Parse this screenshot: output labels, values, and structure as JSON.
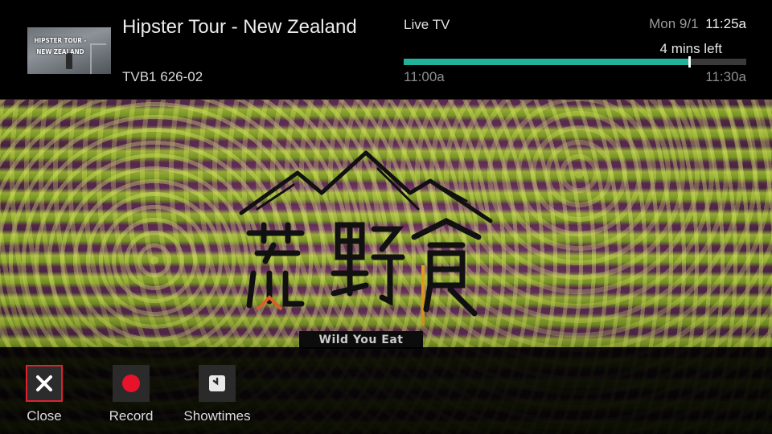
{
  "program": {
    "title": "Hipster Tour - New Zealand",
    "channel_code": "TVB1 626-02",
    "thumbnail_text": "HIPSTER TOUR -\nNEW ZEALAND"
  },
  "status": {
    "source": "Live TV",
    "date": "Mon 9/1",
    "time": "11:25a",
    "time_left": "4 mins left",
    "start_time": "11:00a",
    "end_time": "11:30a",
    "progress_fraction": 0.833
  },
  "video_overlay": {
    "logo_caption": "Wild You Eat"
  },
  "actions": [
    {
      "label": "Close",
      "icon": "close-icon",
      "focused": true
    },
    {
      "label": "Record",
      "icon": "record-icon",
      "focused": false
    },
    {
      "label": "Showtimes",
      "icon": "clock-icon",
      "focused": false
    }
  ],
  "colors": {
    "progress_fill": "#20b39a",
    "focus_border": "#e0212e",
    "record_red": "#e8122a"
  }
}
